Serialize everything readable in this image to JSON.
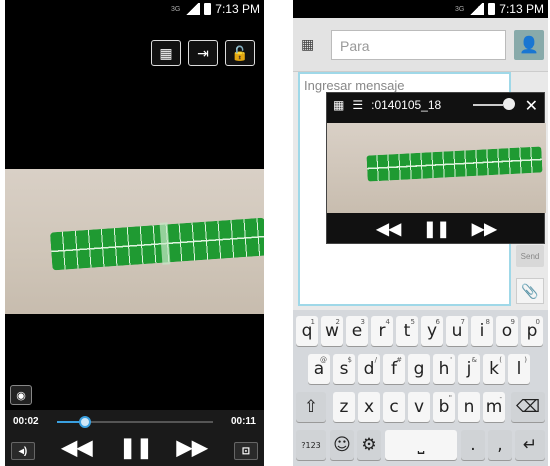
{
  "left": {
    "status_time": "7:13 PM",
    "elapsed": "00:02",
    "total": "00:11",
    "progress": 0.18,
    "icons": [
      "template-icon",
      "exit-icon",
      "unlock-icon",
      "capture-icon",
      "volume-icon",
      "rewind-icon",
      "pause-icon",
      "fast-forward-icon",
      "popup-player-icon"
    ]
  },
  "right": {
    "status_time": "7:13 PM",
    "to_placeholder": "Para",
    "message_placeholder": "Ingresar mensaje",
    "popup_title": ":0140105_18",
    "send_label": "Send",
    "keyboard": {
      "row1": [
        [
          "q",
          "1"
        ],
        [
          "w",
          "2"
        ],
        [
          "e",
          "3"
        ],
        [
          "r",
          "4"
        ],
        [
          "t",
          "5"
        ],
        [
          "y",
          "6"
        ],
        [
          "u",
          "7"
        ],
        [
          "i",
          "8"
        ],
        [
          "o",
          "9"
        ],
        [
          "p",
          "0"
        ]
      ],
      "row2": [
        [
          "a",
          "@"
        ],
        [
          "s",
          "$"
        ],
        [
          "d",
          "/"
        ],
        [
          "f",
          "#"
        ],
        [
          "g",
          ""
        ],
        [
          "h",
          "'"
        ],
        [
          "j",
          "&"
        ],
        [
          "k",
          "("
        ],
        [
          "l",
          ")"
        ]
      ],
      "row3": [
        [
          "z",
          ""
        ],
        [
          "x",
          ""
        ],
        [
          "c",
          ""
        ],
        [
          "v",
          ""
        ],
        [
          "b",
          "\""
        ],
        [
          "n",
          ""
        ],
        [
          "m",
          "-"
        ]
      ],
      "sym_label": "?123"
    }
  }
}
